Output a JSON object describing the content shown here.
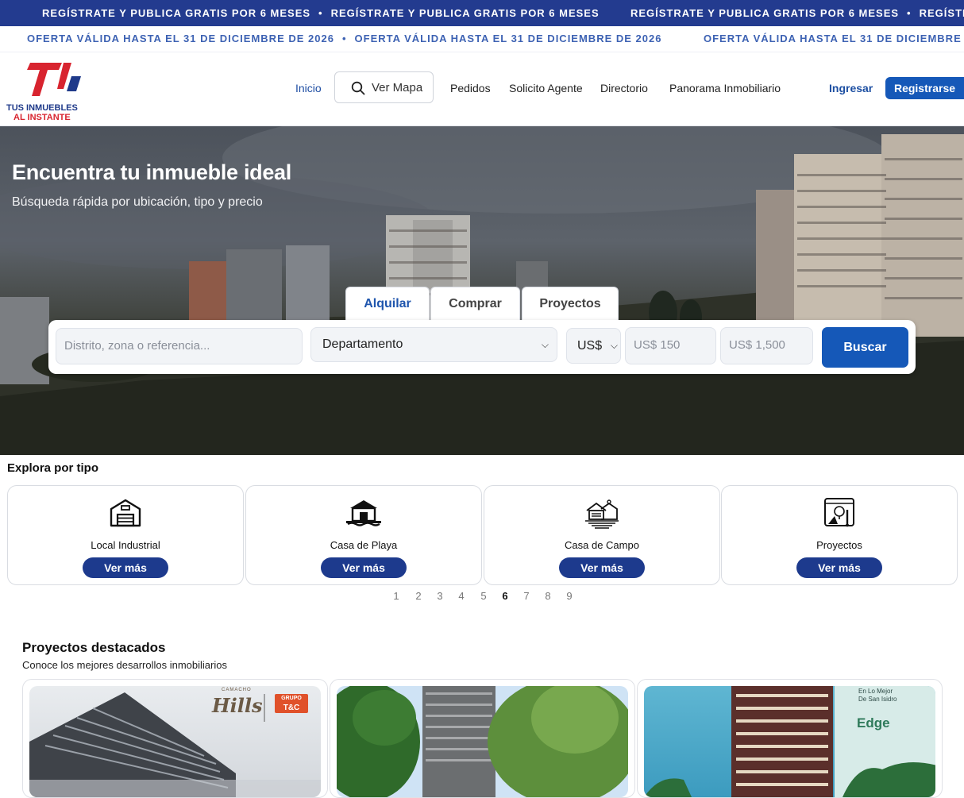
{
  "banner": {
    "promo": "REGÍSTRATE Y PUBLICA GRATIS POR 6 MESES",
    "offer": "OFERTA VÁLIDA HASTA EL 31 DE DICIEMBRE DE 2026",
    "separator": "•"
  },
  "header": {
    "logo_line1": "TUS INMUEBLES",
    "logo_line2": "AL INSTANTE",
    "nav": {
      "inicio": "Inicio",
      "ver_mapa": "Ver Mapa",
      "pedidos": "Pedidos",
      "solicito_agente": "Solicito Agente",
      "directorio": "Directorio",
      "panorama": "Panorama Inmobiliario"
    },
    "login": "Ingresar",
    "register": "Registrarse"
  },
  "hero": {
    "title": "Encuentra tu inmueble ideal",
    "subtitle": "Búsqueda rápida por ubicación, tipo y precio",
    "tabs": [
      "Alquilar",
      "Comprar",
      "Proyectos"
    ],
    "active_tab": "Alquilar",
    "search": {
      "location_placeholder": "Distrito, zona o referencia...",
      "property_type": "Departamento",
      "currency": "US$",
      "min_price_placeholder": "US$ 150",
      "max_price_placeholder": "US$ 1,500",
      "button": "Buscar"
    }
  },
  "explore": {
    "title": "Explora por tipo",
    "cards": [
      {
        "label": "Local Industrial",
        "button": "Ver más",
        "icon": "warehouse-icon"
      },
      {
        "label": "Casa de Playa",
        "button": "Ver más",
        "icon": "beach-house-icon"
      },
      {
        "label": "Casa de Campo",
        "button": "Ver más",
        "icon": "farm-house-icon"
      },
      {
        "label": "Proyectos",
        "button": "Ver más",
        "icon": "blueprint-icon"
      }
    ],
    "pages": [
      "1",
      "2",
      "3",
      "4",
      "5",
      "6",
      "7",
      "8",
      "9"
    ],
    "current_page": "6"
  },
  "projects": {
    "title": "Proyectos destacados",
    "subtitle": "Conoce los mejores desarrollos inmobiliarios",
    "cards": [
      {
        "brand_small": "CAMACHO",
        "brand": "Hills",
        "group": "GRUPO",
        "group_mark": "T&C"
      },
      {},
      {
        "tagline1": "En Lo Mejor",
        "tagline2": "De San Isidro",
        "brand": "Edge"
      }
    ]
  },
  "colors": {
    "brand_blue": "#233b8f",
    "button_blue": "#1558b8",
    "brand_red": "#d8242f"
  }
}
